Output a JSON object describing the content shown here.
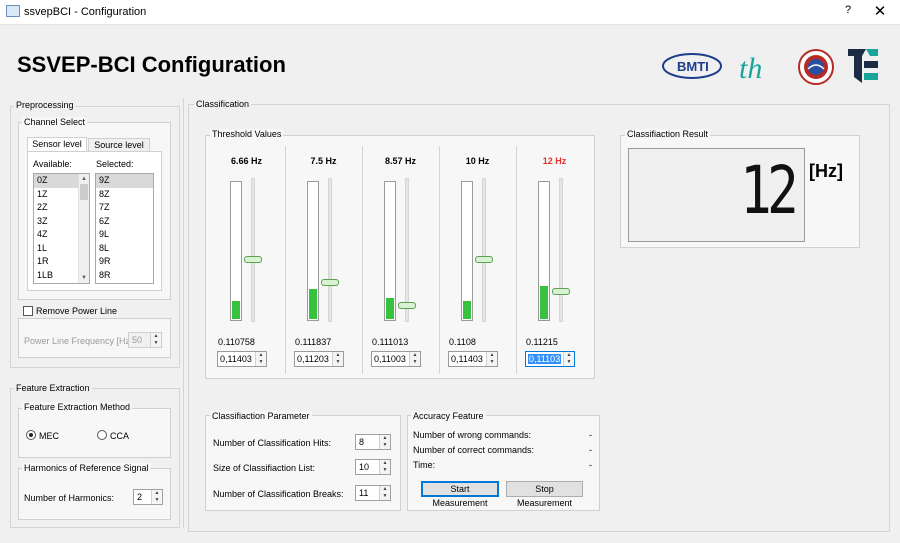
{
  "window": {
    "title": "ssvepBCI - Configuration",
    "help_glyph": "?",
    "close_glyph": "✕"
  },
  "header": {
    "title": "SSVEP-BCI Configuration",
    "logos": [
      "BMTI",
      "th"
    ]
  },
  "preprocessing": {
    "group_label": "Preprocessing",
    "channel_select": {
      "label": "Channel Select",
      "tabs": [
        "Sensor level",
        "Source level"
      ],
      "available_label": "Available:",
      "selected_label": "Selected:",
      "available": [
        "0Z",
        "1Z",
        "2Z",
        "3Z",
        "4Z",
        "1L",
        "1R",
        "1LB"
      ],
      "selected": [
        "9Z",
        "8Z",
        "7Z",
        "6Z",
        "9L",
        "8L",
        "9R",
        "8R"
      ]
    },
    "remove_power_line": {
      "label": "Remove Power Line",
      "checked": false
    },
    "power_line_frequency": {
      "label": "Power Line Frequency [Hz]:",
      "value": "50"
    }
  },
  "feature_extraction": {
    "group_label": "Feature Extraction",
    "method": {
      "label": "Feature Extraction Method",
      "options": [
        "MEC",
        "CCA"
      ],
      "selected": "MEC"
    },
    "harmonics": {
      "label": "Harmonics of Reference Signal",
      "number_label": "Number of Harmonics:",
      "value": "2"
    }
  },
  "classification": {
    "group_label": "Classification",
    "threshold_label": "Threshold Values",
    "channels": [
      {
        "freq": "6.66 Hz",
        "value": "0.110758",
        "threshold": "0,11403",
        "level": 0.13,
        "slider": 0.57,
        "active": false
      },
      {
        "freq": "7.5 Hz",
        "value": "0.111837",
        "threshold": "0,11203",
        "level": 0.22,
        "slider": 0.73,
        "active": false
      },
      {
        "freq": "8.57 Hz",
        "value": "0.111013",
        "threshold": "0,11003",
        "level": 0.15,
        "slider": 0.89,
        "active": false
      },
      {
        "freq": "10 Hz",
        "value": "0.1108",
        "threshold": "0,11403",
        "level": 0.13,
        "slider": 0.57,
        "active": false
      },
      {
        "freq": "12 Hz",
        "value": "0.11215",
        "threshold": "0,11103",
        "level": 0.24,
        "slider": 0.79,
        "active": true
      }
    ],
    "result": {
      "label": "Classifiaction Result",
      "value": "12",
      "unit": "[Hz]"
    },
    "parameters": {
      "label": "Classifiaction Parameter",
      "hits_label": "Number of Classification Hits:",
      "hits": "8",
      "list_label": "Size of Classifiaction List:",
      "list": "10",
      "breaks_label": "Number of Classification Breaks:",
      "breaks": "11"
    },
    "accuracy": {
      "label": "Accuracy Feature",
      "wrong_label": "Number of wrong commands:",
      "wrong": "-",
      "correct_label": "Number of correct commands:",
      "correct": "-",
      "time_label": "Time:",
      "time": "-",
      "start_label": "Start Measurement",
      "stop_label": "Stop Measurement"
    }
  },
  "colors": {
    "bar_fill": "#37c13c",
    "active_freq": "#e0302c",
    "accent": "#0078d7"
  }
}
